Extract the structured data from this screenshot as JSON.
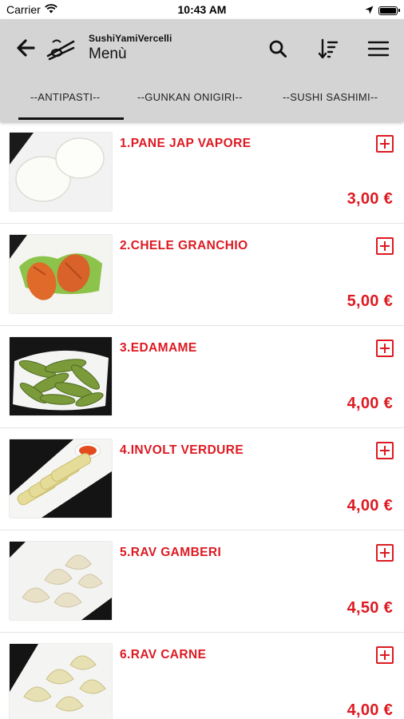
{
  "status_bar": {
    "carrier": "Carrier",
    "time": "10:43 AM"
  },
  "header": {
    "app_name": "SushiYamiVercelli",
    "page_title": "Menù",
    "icons": [
      "back-arrow-icon",
      "chopsticks-logo",
      "search-icon",
      "sort-icon",
      "menu-icon"
    ]
  },
  "tabs": [
    {
      "label": "--ANTIPASTI--",
      "selected": true
    },
    {
      "label": "--GUNKAN ONIGIRI--",
      "selected": false
    },
    {
      "label": "--SUSHI SASHIMI--",
      "selected": false
    }
  ],
  "accent_color": "#dd1a22",
  "items": [
    {
      "name": "1.PANE JAP VAPORE",
      "price": "3,00 €"
    },
    {
      "name": "2.CHELE GRANCHIO",
      "price": "5,00 €"
    },
    {
      "name": "3.EDAMAME",
      "price": "4,00 €"
    },
    {
      "name": "4.INVOLT VERDURE",
      "price": "4,00 €"
    },
    {
      "name": "5.RAV GAMBERI",
      "price": "4,50 €"
    },
    {
      "name": "6.RAV CARNE",
      "price": "4,00 €"
    }
  ]
}
